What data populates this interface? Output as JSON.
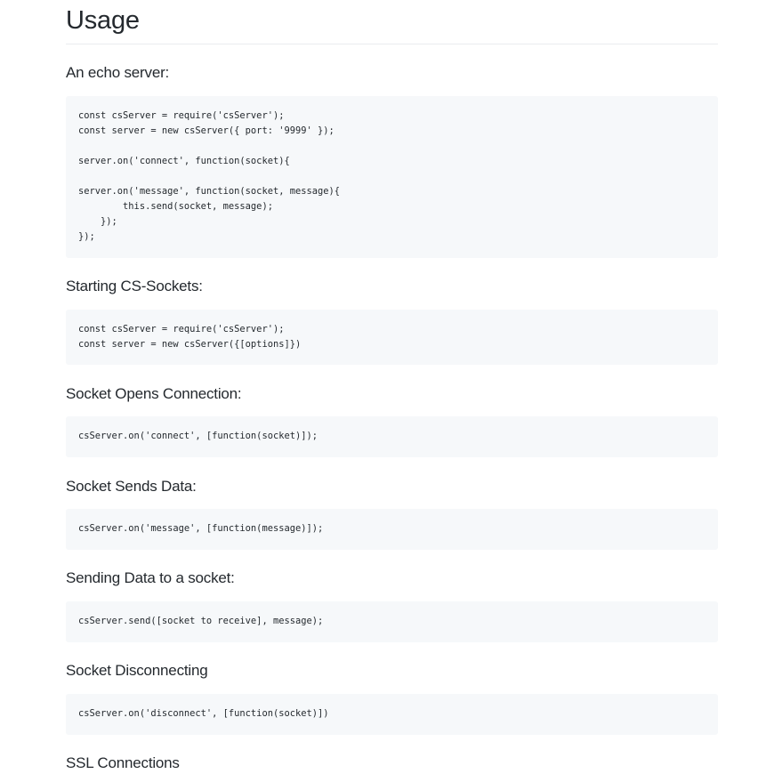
{
  "page_title": "Usage",
  "sections": [
    {
      "heading": "An echo server:",
      "code": [
        "const csServer = require('csServer');",
        "const server = new csServer({ port: '9999' });",
        "",
        "server.on('connect', function(socket){",
        "",
        "server.on('message', function(socket, message){",
        "        this.send(socket, message);",
        "    });",
        "});"
      ]
    },
    {
      "heading": "Starting CS-Sockets:",
      "code": [
        "const csServer = require('csServer');",
        "const server = new csServer({[options]})"
      ]
    },
    {
      "heading": "Socket Opens Connection:",
      "code": [
        "csServer.on('connect', [function(socket)]);"
      ]
    },
    {
      "heading": "Socket Sends Data:",
      "code": [
        "csServer.on('message', [function(message)]);"
      ]
    },
    {
      "heading": "Sending Data to a socket:",
      "code": [
        "csServer.send([socket to receive], message);"
      ]
    },
    {
      "heading": "Socket Disconnecting",
      "code": [
        "csServer.on('disconnect', [function(socket)])"
      ]
    },
    {
      "heading": "SSL Connections",
      "code": []
    }
  ]
}
